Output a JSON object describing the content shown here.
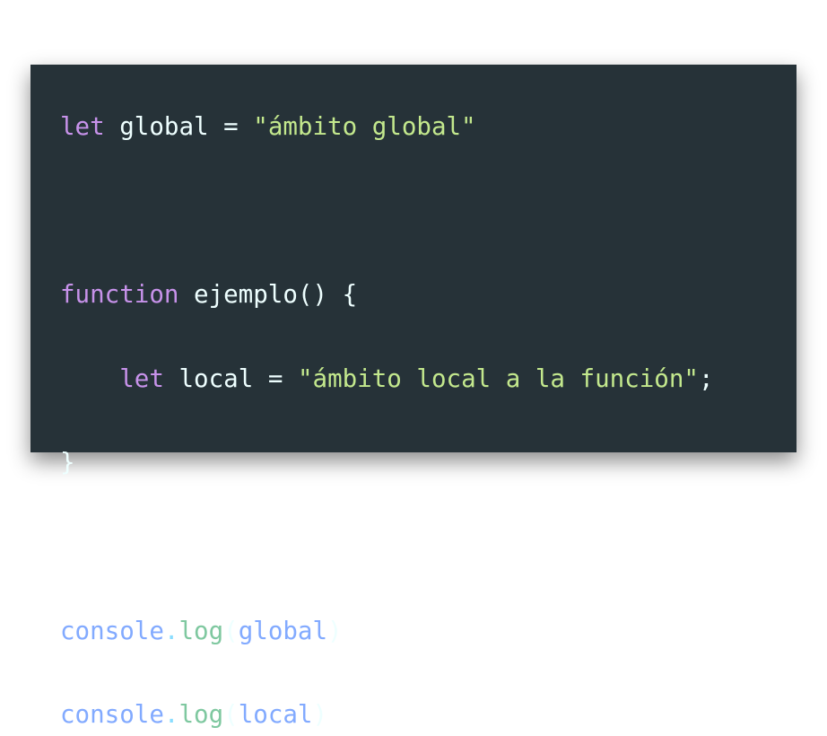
{
  "colors": {
    "background": "#263238",
    "keyword": "#c792ea",
    "string": "#c3e88d",
    "identifier": "#eeffff",
    "object": "#82aaff",
    "method": "#7fc8a0",
    "punctuation": "#89ddff"
  },
  "code": {
    "line1": {
      "kw": "let",
      "name": "global",
      "eq": "=",
      "str": "\"ámbito global\""
    },
    "line3": {
      "kw": "function",
      "name": "ejemplo",
      "rest": "() {"
    },
    "line4": {
      "indent": "    ",
      "kw": "let",
      "name": "local",
      "eq": "=",
      "str": "\"ámbito local a la función\"",
      "end": ";"
    },
    "line5": {
      "brace": "}"
    },
    "line7": {
      "obj": "console",
      "dot": ".",
      "method": "log",
      "open": "(",
      "arg": "global",
      "close": ")"
    },
    "line8": {
      "obj": "console",
      "dot": ".",
      "method": "log",
      "open": "(",
      "arg": "local",
      "close": ")"
    }
  }
}
